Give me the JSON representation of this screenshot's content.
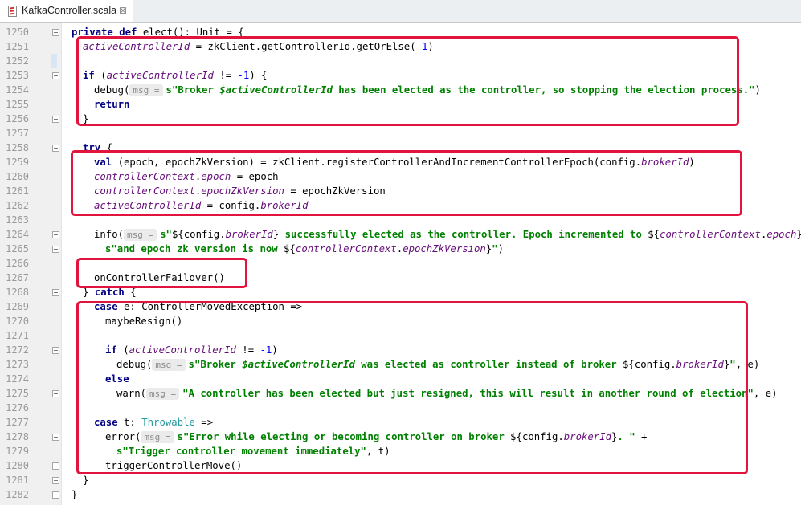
{
  "tab": {
    "file_name": "KafkaController.scala",
    "close_glyph": "⊠",
    "file_icon": "scala-file-icon"
  },
  "colors": {
    "keyword": "#000080",
    "field": "#660e7a",
    "string": "#008000",
    "number": "#0000ff",
    "type": "#20999d",
    "highlight_box": "#e0143c"
  },
  "line_numbers": [
    "1250",
    "1251",
    "1252",
    "1253",
    "1254",
    "1255",
    "1256",
    "1257",
    "1258",
    "1259",
    "1260",
    "1261",
    "1262",
    "1263",
    "1264",
    "1265",
    "1266",
    "1267",
    "1268",
    "1269",
    "1270",
    "1271",
    "1272",
    "1273",
    "1274",
    "1275",
    "1276",
    "1277",
    "1278",
    "1279",
    "1280",
    "1281",
    "1282"
  ],
  "code": {
    "l1250": {
      "kw1": "private def ",
      "t1": "elect(): Unit = {"
    },
    "l1251": {
      "f1": "activeControllerId",
      "t1": " = zkClient.getControllerId.getOrElse(",
      "n1": "-1",
      "t2": ")"
    },
    "l1253": {
      "kw1": "if",
      "t1": " (",
      "f1": "activeControllerId",
      "t2": " != ",
      "n1": "-1",
      "t3": ") {"
    },
    "l1254": {
      "t1": "debug(",
      "hint": "msg =",
      "s1": "s\"Broker ",
      "f1": "$activeControllerId",
      "s2": " has been elected as the controller, so stopping the election process.\"",
      "t2": ")"
    },
    "l1255": {
      "kw1": "return"
    },
    "l1256": {
      "t1": "}"
    },
    "l1258": {
      "kw1": "try",
      "t1": " {"
    },
    "l1259": {
      "kw1": "val",
      "t1": " (epoch, epochZkVersion) = zkClient.registerControllerAndIncrementControllerEpoch(config.",
      "f1": "brokerId",
      "t2": ")"
    },
    "l1260": {
      "f1": "controllerContext",
      "t1": ".",
      "f2": "epoch",
      "t2": " = epoch"
    },
    "l1261": {
      "f1": "controllerContext",
      "t1": ".",
      "f2": "epochZkVersion",
      "t2": " = epochZkVersion"
    },
    "l1262": {
      "f1": "activeControllerId",
      "t1": " = config.",
      "f2": "brokerId"
    },
    "l1264": {
      "t1": "info(",
      "hint": "msg =",
      "s1": "s\"",
      "t2": "${config.",
      "f1": "brokerId",
      "t3": "}",
      "s2": " successfully elected as the controller. Epoch incremented to ",
      "t4": "${",
      "f2": "controllerContext",
      "t5": ".",
      "f3": "epoch",
      "t6": "}",
      "s3": " \"",
      "t7": " +"
    },
    "l1265": {
      "s1": "s\"and epoch zk version is now ",
      "t1": "${",
      "f1": "controllerContext",
      "t2": ".",
      "f2": "epochZkVersion",
      "t3": "}",
      "s2": "\"",
      "t4": ")"
    },
    "l1267": {
      "t1": "onControllerFailover()"
    },
    "l1268": {
      "t1": "} ",
      "kw1": "catch",
      "t2": " {"
    },
    "l1269": {
      "kw1": "case",
      "t1": " e: ControllerMovedException =>"
    },
    "l1270": {
      "t1": "maybeResign()"
    },
    "l1272": {
      "kw1": "if",
      "t1": " (",
      "f1": "activeControllerId",
      "t2": " != ",
      "n1": "-1",
      "t3": ")"
    },
    "l1273": {
      "t1": "debug(",
      "hint": "msg =",
      "s1": "s\"Broker ",
      "f1": "$activeControllerId",
      "s2": " was elected as controller instead of broker ",
      "t2": "${config.",
      "f2": "brokerId",
      "t3": "}",
      "s3": "\"",
      "t4": ", e)"
    },
    "l1274": {
      "kw1": "else"
    },
    "l1275": {
      "t1": "warn(",
      "hint": "msg =",
      "s1": "\"A controller has been elected but just resigned, this will result in another round of election\"",
      "t2": ", e)"
    },
    "l1277": {
      "kw1": "case",
      "t1": " t: ",
      "ty1": "Throwable",
      "t2": " =>"
    },
    "l1278": {
      "t1": "error(",
      "hint": "msg =",
      "s1": "s\"Error while electing or becoming controller on broker ",
      "t2": "${config.",
      "f1": "brokerId",
      "t3": "}",
      "s2": ". \"",
      "t4": " +"
    },
    "l1279": {
      "s1": "s\"Trigger controller movement immediately\"",
      "t1": ", t)"
    },
    "l1280": {
      "t1": "triggerControllerMove()"
    },
    "l1281": {
      "t1": "}"
    },
    "l1282": {
      "t1": "}"
    }
  }
}
